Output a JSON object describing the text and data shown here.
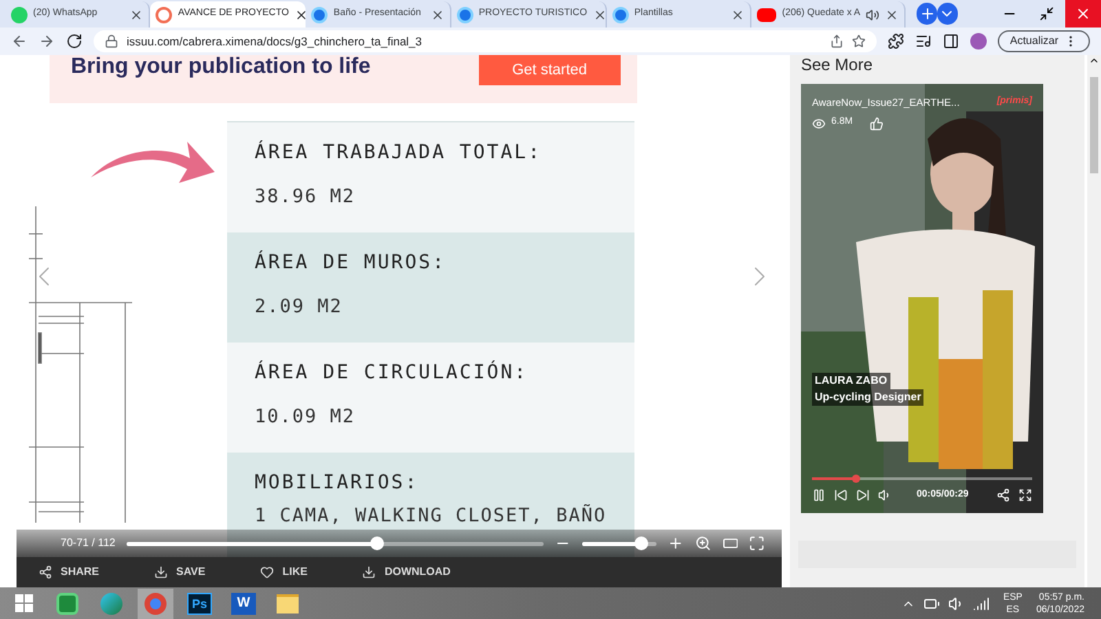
{
  "tabs": [
    {
      "label": "(20) WhatsApp",
      "kind": "whatsapp",
      "selected": false,
      "audio": false
    },
    {
      "label": "AVANCE DE PROYECTO",
      "kind": "issuu",
      "selected": true,
      "audio": false
    },
    {
      "label": "Baño - Presentación",
      "kind": "edge",
      "selected": false,
      "audio": false
    },
    {
      "label": "PROYECTO TURISTICO",
      "kind": "edge",
      "selected": false,
      "audio": false
    },
    {
      "label": "Plantillas",
      "kind": "edge",
      "selected": false,
      "audio": false
    },
    {
      "label": "(206) Quedate x A",
      "kind": "youtube",
      "selected": false,
      "audio": true
    }
  ],
  "address_bar": {
    "url": "issuu.com/cabrera.ximena/docs/g3_chinchero_ta_final_3",
    "update_button": "Actualizar"
  },
  "banner": {
    "text": "Bring your publication to life",
    "button": "Get started"
  },
  "document": {
    "blocks": [
      {
        "heading": "ÁREA TRABAJADA TOTAL:",
        "value": "38.96 M2",
        "color": "#f3f6f7"
      },
      {
        "heading": "ÁREA DE MUROS:",
        "value": "2.09 M2",
        "color": "#dae8e8"
      },
      {
        "heading": "ÁREA DE CIRCULACIÓN:",
        "value": "10.09 M2",
        "color": "#f3f6f7"
      },
      {
        "heading": "MOBILIARIOS:",
        "value": "1 CAMA, WALKING CLOSET, BAÑO",
        "color": "#dae8e8"
      }
    ]
  },
  "viewer": {
    "page_counter": "70-71 / 112",
    "page_slider": {
      "level": 0.6
    },
    "zoom_slider": {
      "level": 0.8
    },
    "actions": [
      "SHARE",
      "SAVE",
      "LIKE",
      "DOWNLOAD"
    ]
  },
  "sidebar": {
    "title": "See More",
    "video": {
      "title": "AwareNow_Issue27_EARTHE...",
      "brand": "[primis]",
      "views": "6.8M",
      "name": "LAURA ZABO",
      "role": "Up-cycling Designer",
      "time": "00:05/00:29",
      "progress": {
        "level": 0.2
      }
    }
  },
  "taskbar": {
    "apps": [
      {
        "kind": "store",
        "active": false
      },
      {
        "kind": "edge",
        "active": false
      },
      {
        "kind": "chrome",
        "active": true
      },
      {
        "kind": "ps",
        "label": "Ps",
        "active": false
      },
      {
        "kind": "word",
        "label": "W",
        "active": false
      },
      {
        "kind": "files",
        "active": false
      }
    ],
    "language": "ESP",
    "layout": "ES",
    "time": "05:57 p.m.",
    "date": "06/10/2022"
  }
}
